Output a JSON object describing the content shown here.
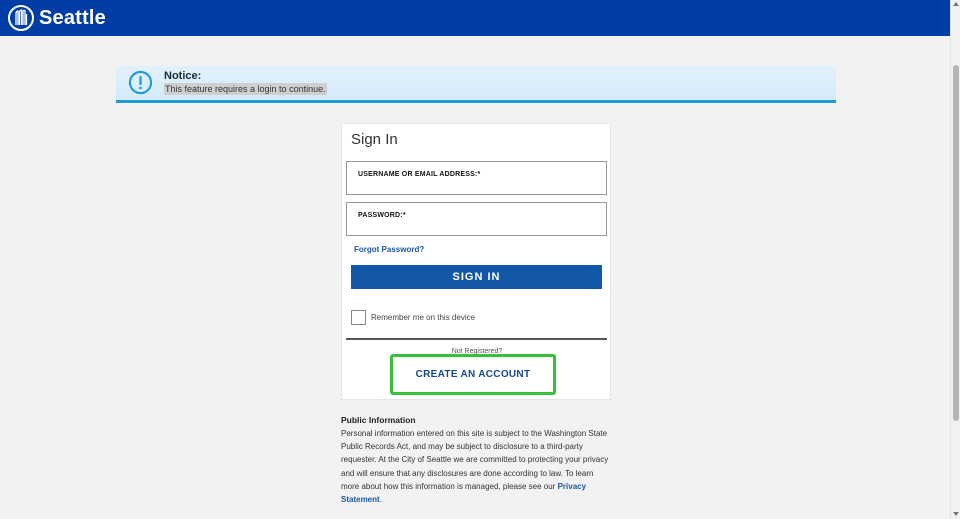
{
  "header": {
    "logo_text": "Seattle",
    "background_color": "#003da5"
  },
  "notice": {
    "icon": "info-circle-icon",
    "title": "Notice:",
    "message": "This feature requires a login to continue.",
    "accent_color": "#1e9bd7"
  },
  "signin": {
    "title": "Sign In",
    "username_label": "USERNAME OR EMAIL ADDRESS:*",
    "username_value": "",
    "password_label": "PASSWORD:*",
    "password_value": "",
    "forgot_label": "Forgot Password?",
    "signin_button": "SIGN IN",
    "remember_label": "Remember me on this device",
    "remember_checked": false,
    "not_registered": "Not Registered?",
    "create_account_button": "CREATE AN ACCOUNT",
    "button_color": "#1357a8",
    "highlight_color": "#39c03a"
  },
  "public_info": {
    "heading": "Public Information",
    "body": "Personal information entered on this site is subject to the Washington State Public Records Act, and may be subject to disclosure to a third-party requester. At the City of Seattle we are committed to protecting your privacy and will ensure that any disclosures are done according to law. To learn more about how this information is managed, please see our ",
    "link_text": "Privacy Statement",
    "trailing": "."
  }
}
